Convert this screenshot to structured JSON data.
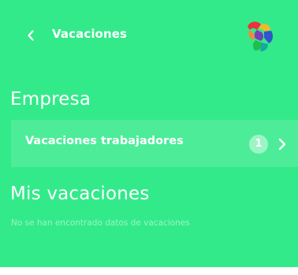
{
  "header": {
    "title": "Vacaciones",
    "back_icon": "chevron-left-icon",
    "logo_icon": "app-logo-icon"
  },
  "company": {
    "section_title": "Empresa",
    "row_label": "Vacaciones trabajadores",
    "badge_count": "1",
    "row_icon": "chevron-right-icon"
  },
  "mine": {
    "section_title": "Mis vacaciones",
    "empty_message": "No se han encontrado datos de vacaciones"
  },
  "colors": {
    "background": "#33ea8a",
    "text": "#ffffff",
    "logo_red": "#e8343d",
    "logo_yellow": "#f5b729",
    "logo_blue": "#2f57c9",
    "logo_purple": "#7a3fb8",
    "logo_green": "#1fbf4f"
  }
}
